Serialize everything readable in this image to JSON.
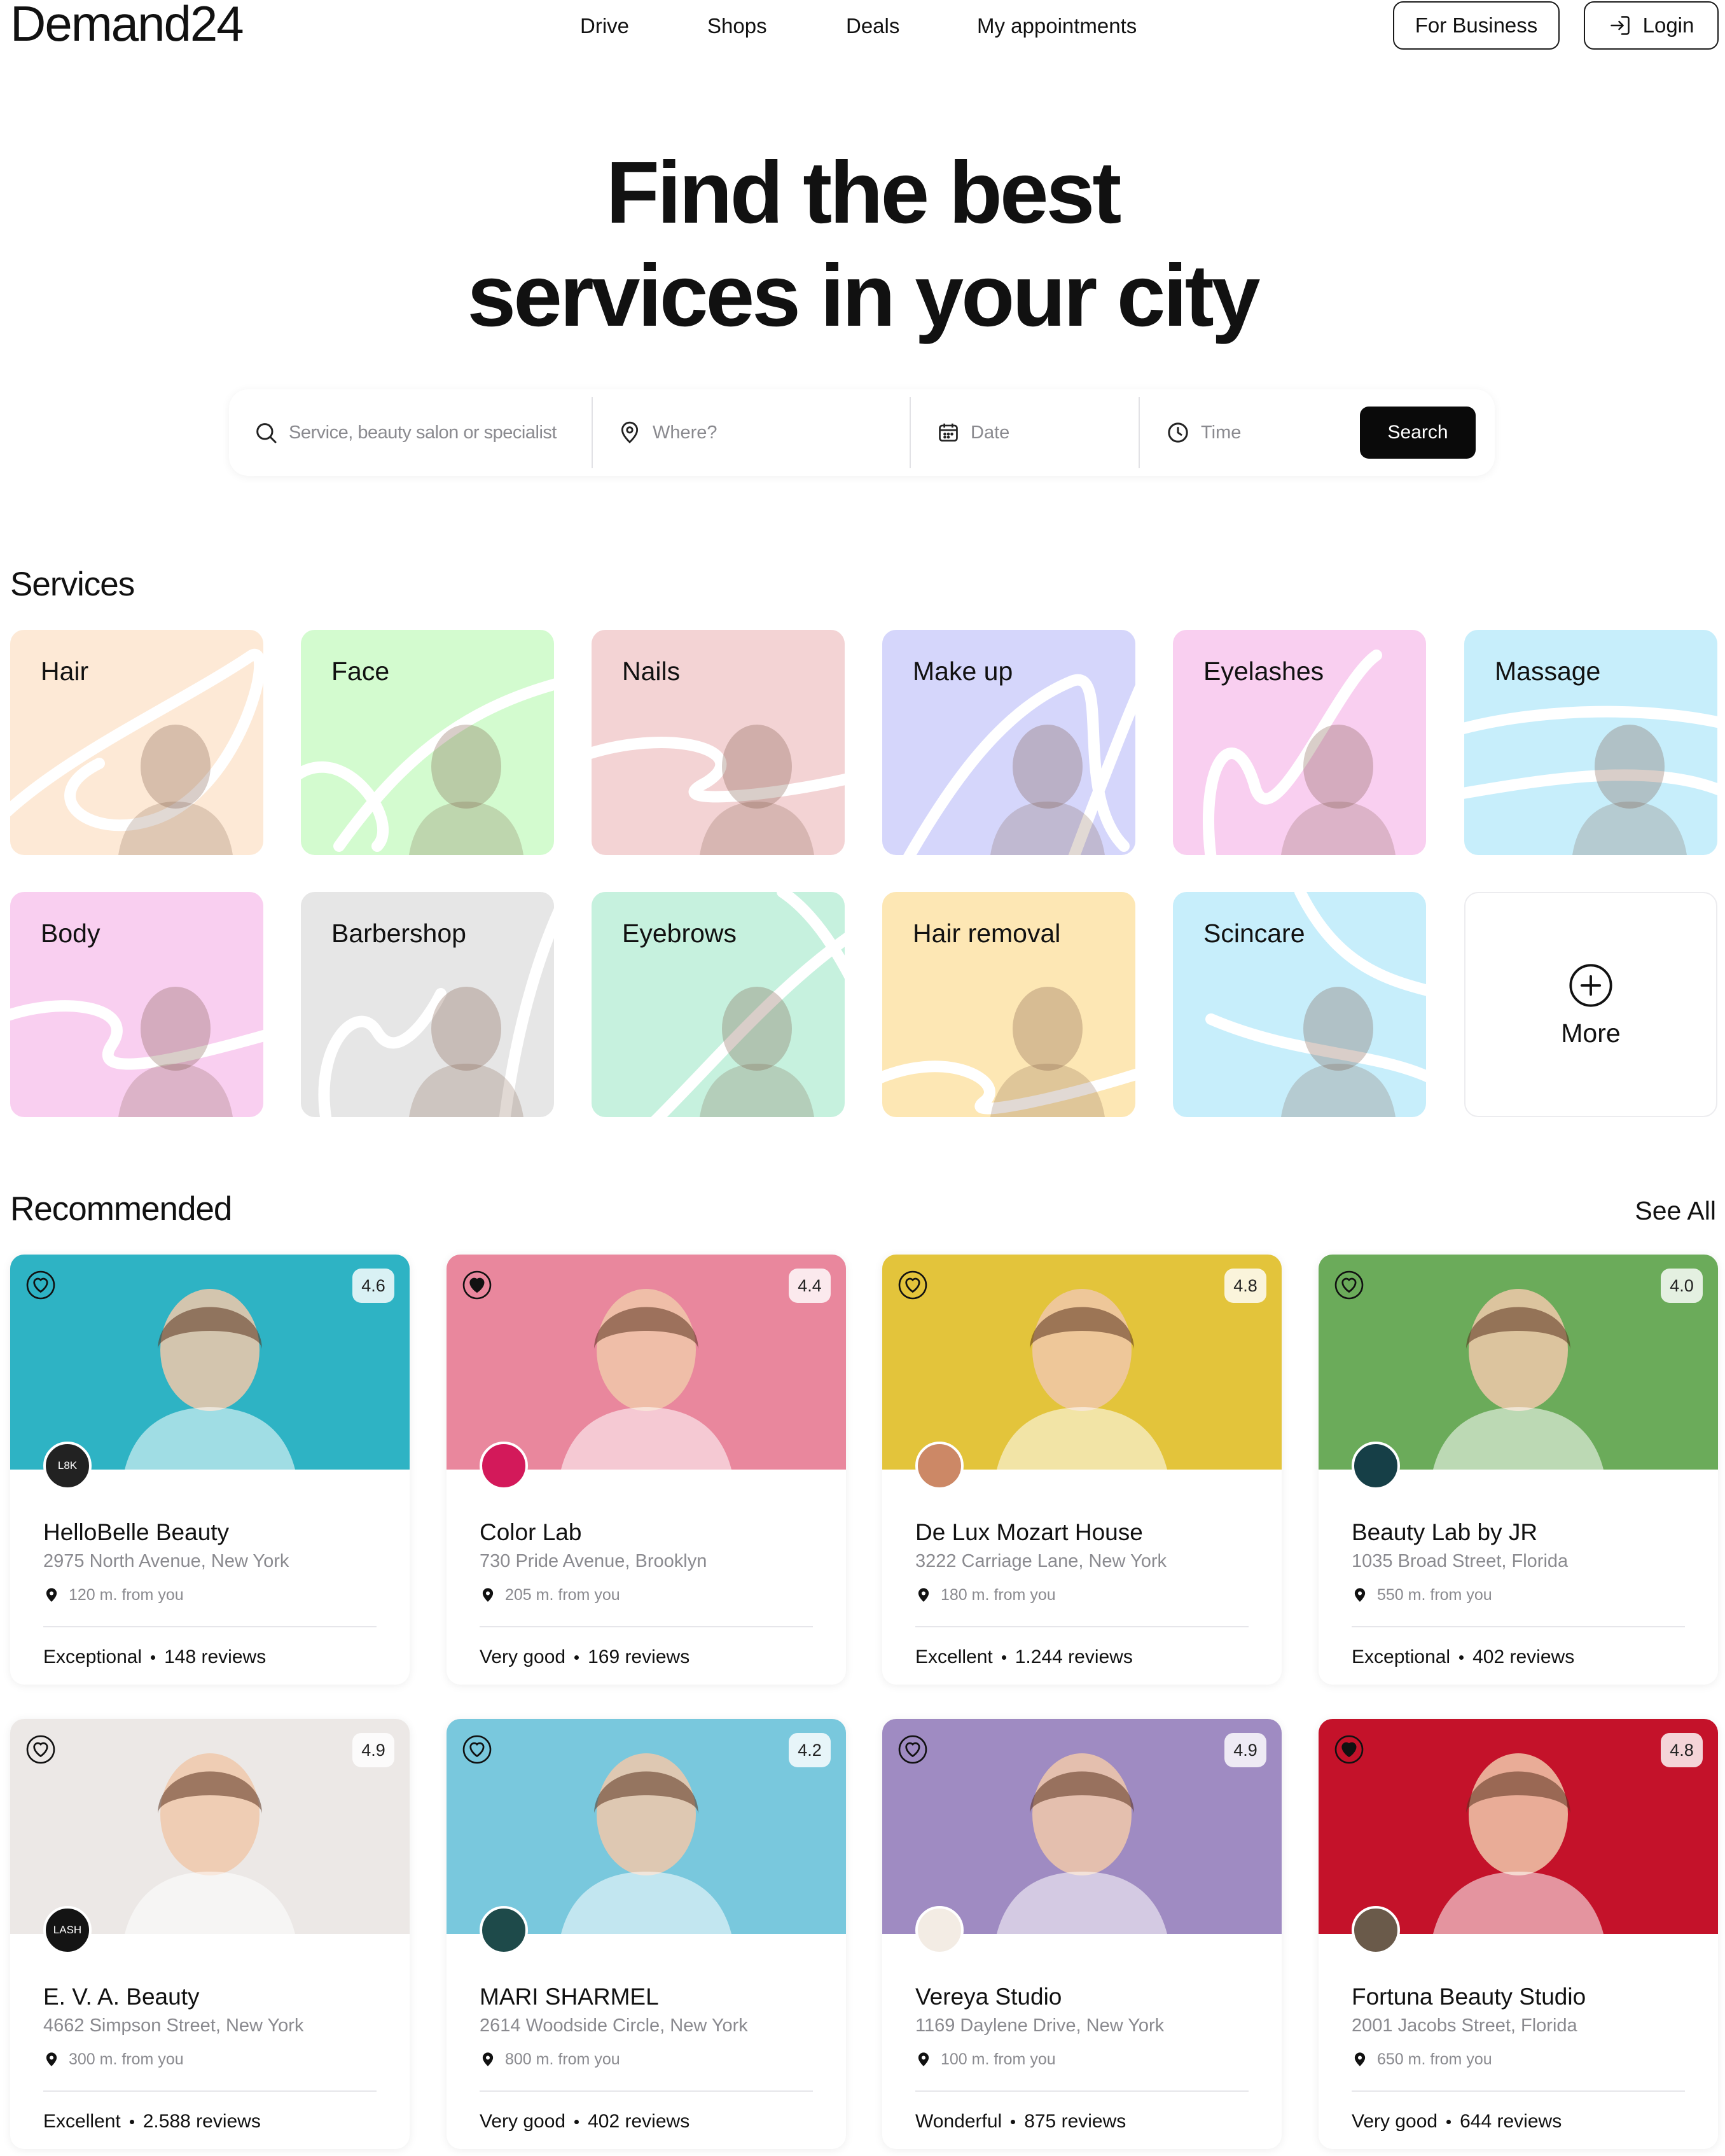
{
  "header": {
    "logo": "Demand24",
    "nav": [
      "Drive",
      "Shops",
      "Deals",
      "My appointments"
    ],
    "for_business": "For Business",
    "login": "Login"
  },
  "hero": {
    "title_line1": "Find the best",
    "title_line2": "services in your city"
  },
  "search": {
    "service_placeholder": "Service, beauty salon or specialist",
    "where_placeholder": "Where?",
    "date_placeholder": "Date",
    "time_placeholder": "Time",
    "button": "Search"
  },
  "services": {
    "title": "Services",
    "items": [
      {
        "label": "Hair",
        "color": "#fde9d6"
      },
      {
        "label": "Face",
        "color": "#d3fbcf"
      },
      {
        "label": "Nails",
        "color": "#f3d3d4"
      },
      {
        "label": "Make up",
        "color": "#d5d6fb"
      },
      {
        "label": "Eyelashes",
        "color": "#f9cff0"
      },
      {
        "label": "Massage",
        "color": "#c7eefb"
      },
      {
        "label": "Body",
        "color": "#f9cff0"
      },
      {
        "label": "Barbershop",
        "color": "#e6e6e6"
      },
      {
        "label": "Eyebrows",
        "color": "#c6f1de"
      },
      {
        "label": "Hair removal",
        "color": "#fde7b4"
      },
      {
        "label": "Scincare",
        "color": "#c7eefb"
      }
    ],
    "more": "More"
  },
  "recommended": {
    "title": "Recommended",
    "see_all": "See All",
    "cards": [
      {
        "name": "HelloBelle Beauty",
        "address": "2975 North Avenue, New York",
        "distance": "120 m. from you",
        "rating": "4.6",
        "rating_text": "Exceptional",
        "reviews": "148 reviews",
        "bg": "#2eb3c4",
        "favorite": false,
        "logo_text": "L8K",
        "logo_color": "#222222"
      },
      {
        "name": "Color Lab",
        "address": "730 Pride Avenue, Brooklyn",
        "distance": "205 m. from you",
        "rating": "4.4",
        "rating_text": "Very good",
        "reviews": "169 reviews",
        "bg": "#e9879d",
        "favorite": true,
        "logo_text": "",
        "logo_color": "#d3195a"
      },
      {
        "name": "De Lux Mozart House",
        "address": "3222 Carriage Lane, New York",
        "distance": "180 m. from you",
        "rating": "4.8",
        "rating_text": "Excellent",
        "reviews": "1.244 reviews",
        "bg": "#e3c43b",
        "favorite": false,
        "logo_text": "",
        "logo_color": "#cc8866"
      },
      {
        "name": "Beauty Lab by JR",
        "address": "1035 Broad Street, Florida",
        "distance": "550 m. from you",
        "rating": "4.0",
        "rating_text": "Exceptional",
        "reviews": "402 reviews",
        "bg": "#6bab5a",
        "favorite": false,
        "logo_text": "",
        "logo_color": "#163f47"
      },
      {
        "name": "E. V. A. Beauty",
        "address": "4662 Simpson Street, New York",
        "distance": "300 m. from you",
        "rating": "4.9",
        "rating_text": "Excellent",
        "reviews": "2.588 reviews",
        "bg": "#ece8e6",
        "favorite": false,
        "logo_text": "LASH",
        "logo_color": "#141414"
      },
      {
        "name": "MARI SHARMEL",
        "address": "2614 Woodside Circle, New York",
        "distance": "800 m. from you",
        "rating": "4.2",
        "rating_text": "Very good",
        "reviews": "402 reviews",
        "bg": "#79c8dd",
        "favorite": false,
        "logo_text": "",
        "logo_color": "#1e4a4a"
      },
      {
        "name": "Vereya Studio",
        "address": "1169 Daylene Drive, New York",
        "distance": "100 m. from you",
        "rating": "4.9",
        "rating_text": "Wonderful",
        "reviews": "875 reviews",
        "bg": "#9f8bc2",
        "favorite": false,
        "logo_text": "",
        "logo_color": "#f3ece4"
      },
      {
        "name": "Fortuna Beauty Studio",
        "address": "2001 Jacobs Street, Florida",
        "distance": "650 m. from you",
        "rating": "4.8",
        "rating_text": "Very good",
        "reviews": "644 reviews",
        "bg": "#c4122a",
        "favorite": true,
        "logo_text": "",
        "logo_color": "#6a5a4a"
      }
    ]
  }
}
